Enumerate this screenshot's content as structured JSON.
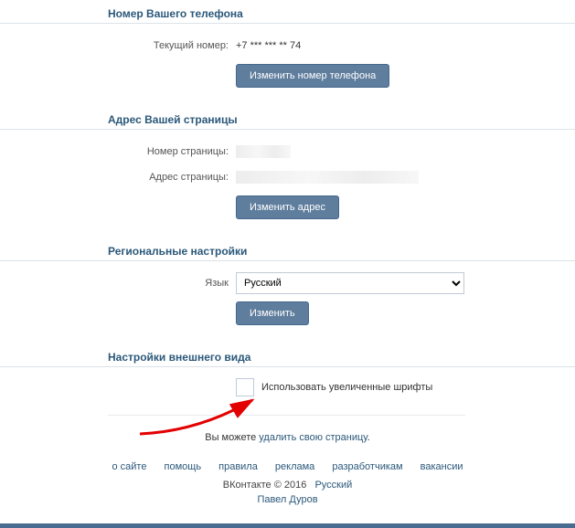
{
  "phone": {
    "header": "Номер Вашего телефона",
    "current_label": "Текущий номер:",
    "current_value": "+7 *** *** ** 74",
    "change_btn": "Изменить номер телефона"
  },
  "address": {
    "header": "Адрес Вашей страницы",
    "page_number_label": "Номер страницы:",
    "page_address_label": "Адрес страницы:",
    "change_btn": "Изменить адрес"
  },
  "regional": {
    "header": "Региональные настройки",
    "lang_label": "Язык",
    "lang_value": "Русский",
    "change_btn": "Изменить"
  },
  "appearance": {
    "header": "Настройки внешнего вида",
    "large_fonts_label": "Использовать увеличенные шрифты"
  },
  "delete": {
    "prefix": "Вы можете ",
    "link": "удалить свою страницу",
    "suffix": "."
  },
  "footer": {
    "links": [
      "о сайте",
      "помощь",
      "правила",
      "реклама",
      "разработчикам",
      "вакансии"
    ],
    "copy_prefix": "ВКонтакте © 2016",
    "copy_lang": "Русский",
    "author": "Павел Дуров"
  }
}
